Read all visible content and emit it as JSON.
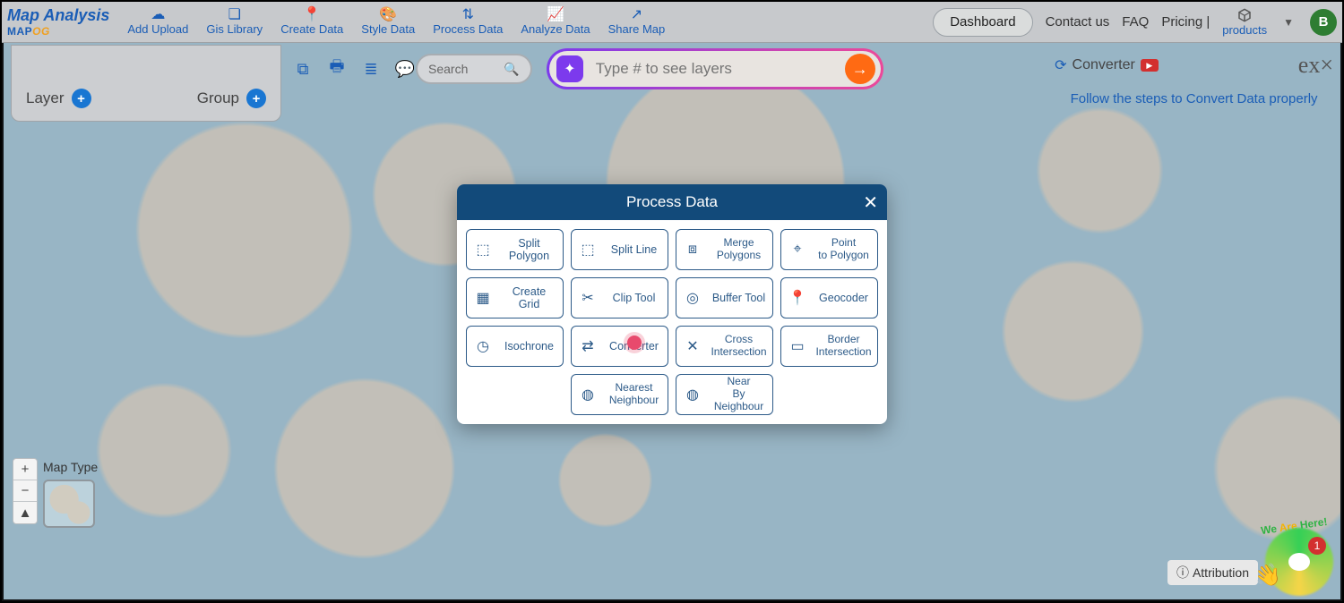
{
  "brand": {
    "title": "Map Analysis",
    "sub_a": "MAP",
    "sub_b": "OG"
  },
  "nav": [
    {
      "label": "Add Upload",
      "icon": "☁"
    },
    {
      "label": "Gis Library",
      "icon": "❏"
    },
    {
      "label": "Create Data",
      "icon": "📍"
    },
    {
      "label": "Style Data",
      "icon": "🎨"
    },
    {
      "label": "Process Data",
      "icon": "⇅"
    },
    {
      "label": "Analyze Data",
      "icon": "📈"
    },
    {
      "label": "Share Map",
      "icon": "↗"
    }
  ],
  "top_right": {
    "dashboard": "Dashboard",
    "contact": "Contact us",
    "faq": "FAQ",
    "pricing": "Pricing |",
    "products": "products",
    "avatar": "B"
  },
  "layer_panel": {
    "layer": "Layer",
    "group": "Group"
  },
  "toolstrip_icons": [
    "⧉",
    "🖶",
    "≣",
    "💬"
  ],
  "search": {
    "placeholder": "Search"
  },
  "layer_input": {
    "placeholder": "Type # to see layers"
  },
  "converter": {
    "label": "Converter",
    "exx": "ex×",
    "follow": "Follow the steps to Convert Data properly"
  },
  "modal": {
    "title": "Process Data",
    "cells": [
      {
        "icon": "⬚",
        "label": "Split Polygon"
      },
      {
        "icon": "⬚",
        "label": "Split Line"
      },
      {
        "icon": "⧈",
        "label": "Merge Polygons",
        "two": true
      },
      {
        "icon": "⌖",
        "label": "Point to Polygon",
        "two": true
      },
      {
        "icon": "▦",
        "label": "Create Grid"
      },
      {
        "icon": "✂",
        "label": "Clip Tool"
      },
      {
        "icon": "◎",
        "label": "Buffer Tool"
      },
      {
        "icon": "📍",
        "label": "Geocoder"
      },
      {
        "icon": "◷",
        "label": "Isochrone"
      },
      {
        "icon": "⇄",
        "label": "Converter"
      },
      {
        "icon": "✕",
        "label": "Cross Intersection",
        "two": true
      },
      {
        "icon": "▭",
        "label": "Border Intersection",
        "two": true
      },
      {
        "icon": "",
        "label": "",
        "empty": true
      },
      {
        "icon": "◍",
        "label": "Nearest Neighbour",
        "two": true
      },
      {
        "icon": "◍",
        "label": "Near By Neighbour",
        "two": true
      },
      {
        "icon": "",
        "label": "",
        "empty": true
      }
    ]
  },
  "maptype": {
    "label": "Map Type"
  },
  "zoom": {
    "in": "+",
    "out": "−",
    "reset": "▲"
  },
  "attribution": "Attribution",
  "chat": {
    "label_a": "We ",
    "label_b": "Are ",
    "label_c": "Here!",
    "badge": "1"
  }
}
